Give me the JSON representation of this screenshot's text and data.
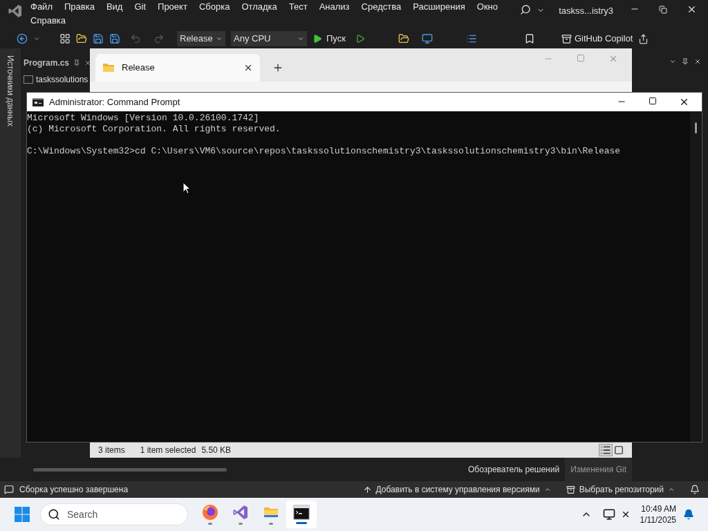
{
  "vs": {
    "menu_rows": [
      [
        "Файл",
        "Правка",
        "Вид",
        "Git",
        "Проект",
        "Сборка",
        "Отладка",
        "Тест",
        "Анализ",
        "Средства",
        "Расширения",
        "Окно"
      ],
      [
        "Справка"
      ]
    ],
    "title": "taskss...istry3",
    "toolbar": {
      "configuration": "Release",
      "platform": "Any CPU",
      "run": "Пуск",
      "copilot": "GitHub Copilot"
    },
    "side_tab": "Источники данных",
    "editor_tab": "Program.cs",
    "editor_file": "taskssolutions",
    "bottom_tabs": [
      {
        "label": "Обозреватель решений",
        "selected": true
      },
      {
        "label": "Изменения Git",
        "selected": false
      }
    ],
    "status": {
      "message": "Сборка успешно завершена",
      "source_control": "Добавить в систему управления версиями",
      "repository": "Выбрать репозиторий"
    }
  },
  "explorer": {
    "tab": "Release",
    "items": "3 items",
    "selected": "1 item selected",
    "size": "5.50 KB"
  },
  "cmd": {
    "title": "Administrator: Command Prompt",
    "lines": [
      "Microsoft Windows [Version 10.0.26100.1742]",
      "(c) Microsoft Corporation. All rights reserved."
    ],
    "prompt": "C:\\Windows\\System32>cd C:\\Users\\VM6\\source\\repos\\taskssolutionschemistry3\\taskssolutionschemistry3\\bin\\Release"
  },
  "taskbar": {
    "search": "Search",
    "apps": [
      {
        "kind": "firefox",
        "selected": false
      },
      {
        "kind": "visualstudio",
        "selected": false
      },
      {
        "kind": "explorer",
        "selected": false
      },
      {
        "kind": "terminal",
        "selected": true
      }
    ],
    "time": "10:49 AM",
    "date": "1/11/2025"
  }
}
